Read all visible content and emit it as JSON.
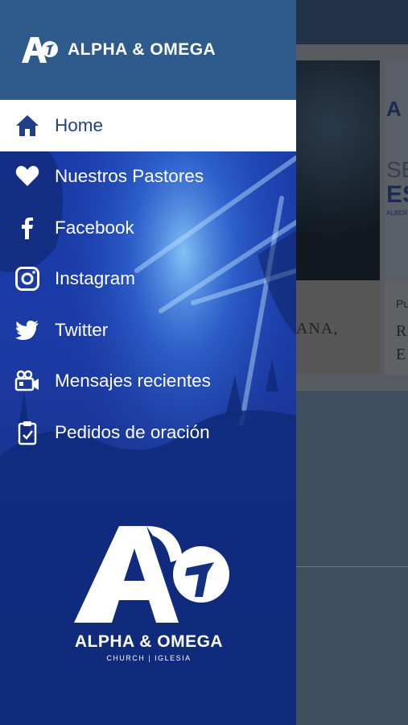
{
  "app": {
    "brand_name": "ALPHA & OMEGA",
    "brand_sub": "CHURCH | IGLESIA",
    "colors": {
      "drawer_header": "#2e5a8c",
      "drawer_bg": "#1a3aa6",
      "active_text": "#1f3f86"
    }
  },
  "menu": {
    "items": [
      {
        "label": "Home",
        "icon": "home-icon",
        "active": true
      },
      {
        "label": "Nuestros Pastores",
        "icon": "heart-icon",
        "active": false
      },
      {
        "label": "Facebook",
        "icon": "facebook-icon",
        "active": false
      },
      {
        "label": "Instagram",
        "icon": "instagram-icon",
        "active": false
      },
      {
        "label": "Twitter",
        "icon": "twitter-icon",
        "active": false
      },
      {
        "label": "Mensajes recientes",
        "icon": "video-camera-icon",
        "active": false
      },
      {
        "label": "Pedidos de oración",
        "icon": "clipboard-icon",
        "active": false
      }
    ]
  },
  "background": {
    "card1_text": "ANA,",
    "card2_logo": "A",
    "card2_se": "SE",
    "card2_es": "ES",
    "card2_al": "ALBER",
    "card2_pu": "Pu",
    "card2_r1": "R",
    "card2_r2": "E"
  }
}
